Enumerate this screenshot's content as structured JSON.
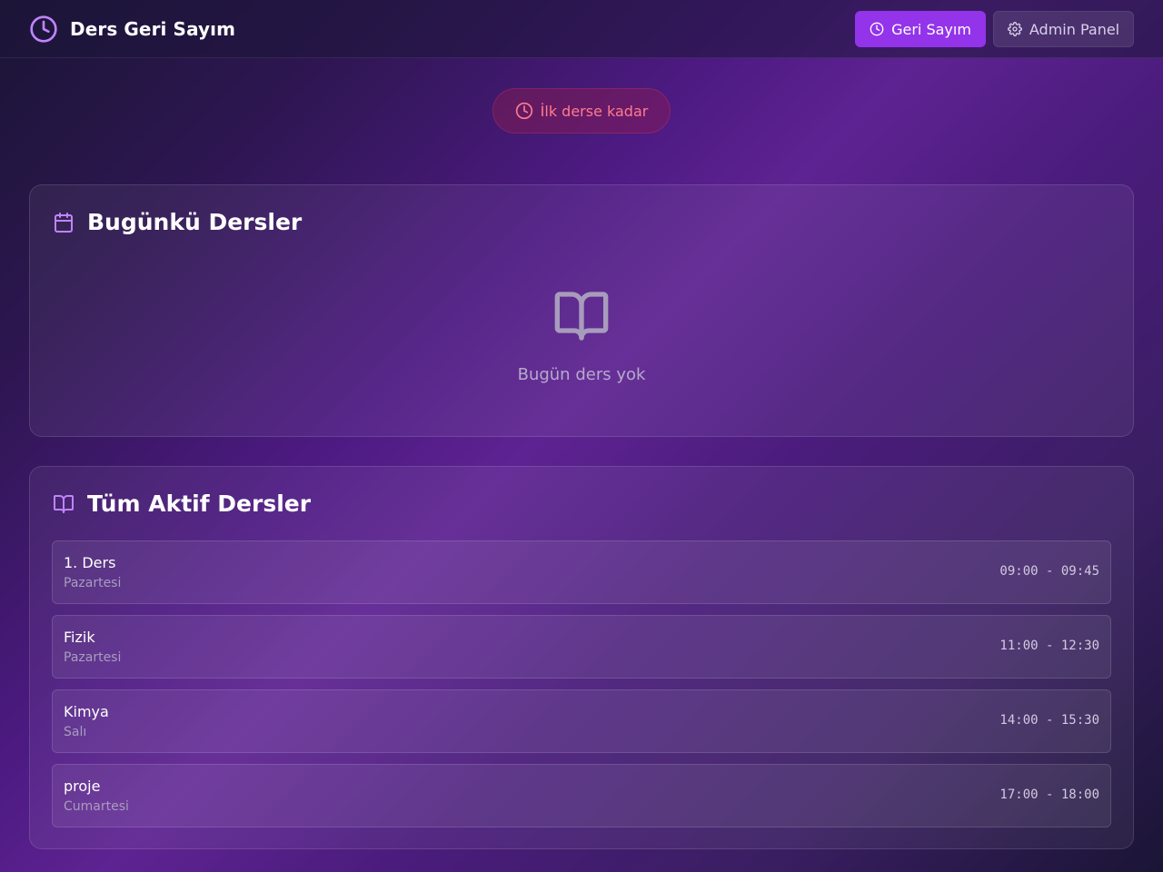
{
  "app": {
    "title": "Ders Geri Sayım"
  },
  "nav": {
    "countdown_label": "Geri Sayım",
    "admin_label": "Admin Panel"
  },
  "status": {
    "text": "İlk derse kadar"
  },
  "today": {
    "title": "Bugünkü Dersler",
    "empty_text": "Bugün ders yok"
  },
  "active": {
    "title": "Tüm Aktif Dersler",
    "lessons": [
      {
        "name": "1. Ders",
        "day": "Pazartesi",
        "time": "09:00 - 09:45"
      },
      {
        "name": "Fizik",
        "day": "Pazartesi",
        "time": "11:00 - 12:30"
      },
      {
        "name": "Kimya",
        "day": "Salı",
        "time": "14:00 - 15:30"
      },
      {
        "name": "proje",
        "day": "Cumartesi",
        "time": "17:00 - 18:00"
      }
    ]
  },
  "icons": {
    "brand": "clock-icon",
    "countdown": "clock-icon",
    "admin": "gear-icon",
    "status": "clock-icon",
    "today": "calendar-icon",
    "empty": "book-open-icon",
    "active": "book-open-icon"
  },
  "colors": {
    "accent": "#9333ea",
    "brand_icon": "#c084fc",
    "status_text": "#ff7b8e"
  }
}
